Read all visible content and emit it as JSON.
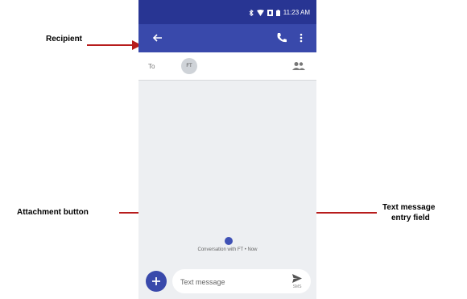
{
  "callouts": {
    "recipient": "Recipient",
    "attachment": "Attachment button",
    "text_entry_line1": "Text message",
    "text_entry_line2": "entry field"
  },
  "status_bar": {
    "time": "11:23 AM",
    "icons": [
      "bluetooth-icon",
      "wifi-icon",
      "signal-icon",
      "battery-icon"
    ]
  },
  "app_bar": {
    "icons": [
      "back-arrow-icon",
      "phone-icon",
      "more-vert-icon"
    ]
  },
  "recipient_row": {
    "to_label": "To",
    "chip": "FT",
    "icon": "add-people-icon"
  },
  "conversation": {
    "caption": "Conversation with FT • Now"
  },
  "compose": {
    "placeholder": "Text message",
    "send_label": "SMS"
  },
  "colors": {
    "status_bar": "#283593",
    "app_bar": "#3949ab",
    "background": "#edeff2",
    "arrow": "#b71c1c"
  }
}
